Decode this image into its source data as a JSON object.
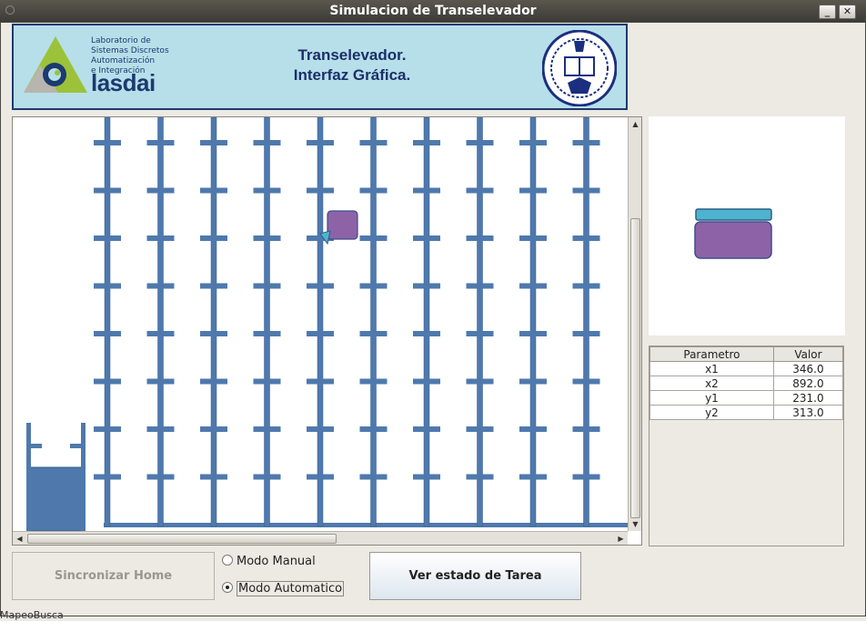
{
  "window": {
    "title": "Simulacion de Transelevador",
    "minimize_label": "_",
    "close_label": "✕"
  },
  "banner": {
    "lab_lines": [
      "Laboratorio de",
      "Sistemas Discretos",
      "Automatización",
      "e Integración"
    ],
    "lab_name": "lasdai",
    "title_line1": "Transelevador.",
    "title_line2": "Interfaz Gráfica.",
    "colors": {
      "background": "#b7dfe9",
      "border": "#1f3a6e",
      "text": "#1b2f6a"
    }
  },
  "rack": {
    "columns": 10,
    "rows": 8,
    "color": "#4f79ad",
    "carriage_color": "#8e62a7",
    "carriage_row": 3,
    "carriage_column": 5
  },
  "preview": {
    "tray_color": "#4fb3cf",
    "box_color": "#8e62a7"
  },
  "params_table": {
    "headers": [
      "Parametro",
      "Valor"
    ],
    "rows": [
      [
        "x1",
        "346.0"
      ],
      [
        "x2",
        "892.0"
      ],
      [
        "y1",
        "231.0"
      ],
      [
        "y2",
        "313.0"
      ]
    ]
  },
  "controls": {
    "sync_label": "Sincronizar Home",
    "modo_manual_label": "Modo Manual",
    "modo_automatico_label": "Modo Automatico",
    "selected_mode": "automatico",
    "task_label": "Ver estado de Tarea"
  },
  "taskbar_text": "MapeoBusca"
}
